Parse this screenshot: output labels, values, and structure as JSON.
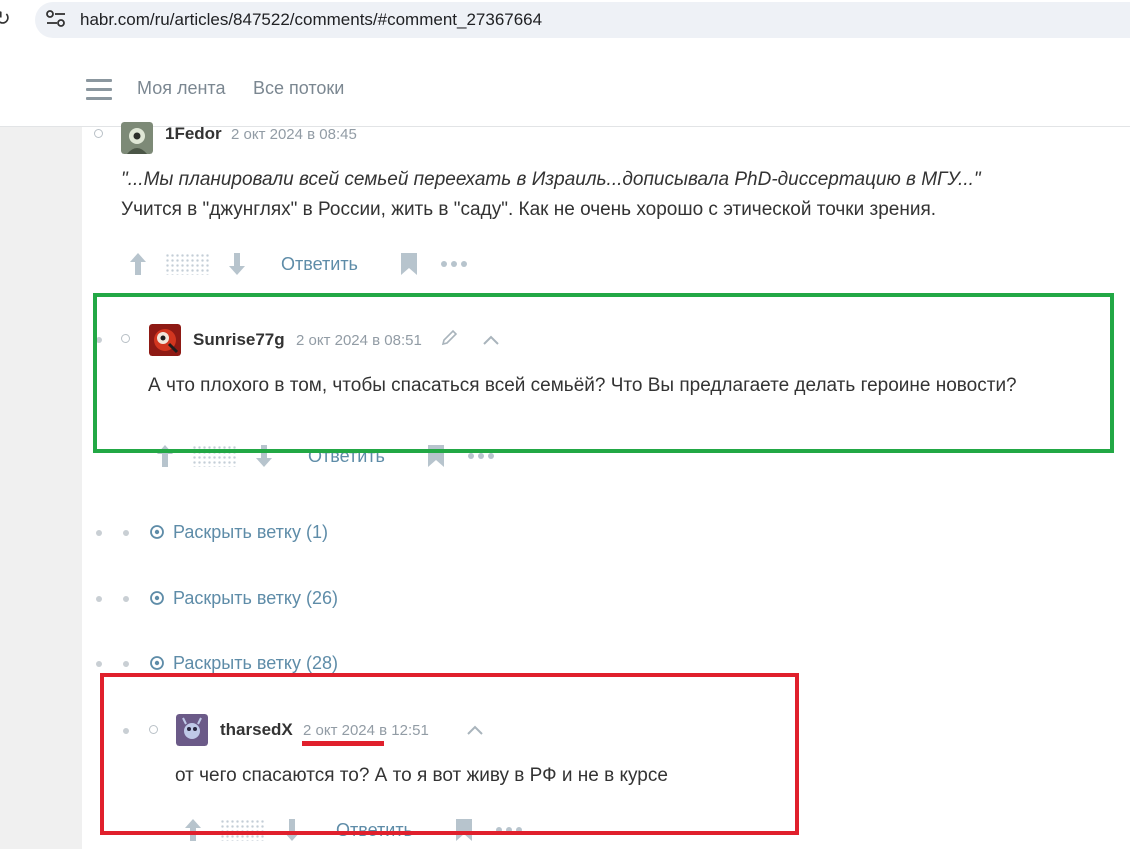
{
  "browser": {
    "url": "habr.com/ru/articles/847522/comments/#comment_27367664"
  },
  "header": {
    "nav": [
      "Моя лента",
      "Все потоки"
    ]
  },
  "comments": [
    {
      "author": "1Fedor",
      "date": "2 окт 2024 в 08:45",
      "line1": "\"...Мы планировали всей семьей переехать в Израиль...дописывала PhD-диссертацию в МГУ...\"",
      "line2": "Учится в \"джунглях\" в России, жить в \"саду\". Как не очень хорошо с этической точки зрения.",
      "reply_label": "Ответить"
    },
    {
      "author": "Sunrise77g",
      "date": "2 окт 2024 в 08:51",
      "text": "А что плохого в том, чтобы спасаться всей семьёй? Что Вы предлагаете делать героине новости?",
      "reply_label": "Ответить"
    },
    {
      "author": "tharsedX",
      "date_part": "2 окт 2024",
      "time_part": " в 12:51",
      "text": "от чего спасаются то? А то я вот живу в РФ и не в курсе",
      "reply_label": "Ответить"
    }
  ],
  "branches": [
    {
      "label": "Раскрыть ветку (1)"
    },
    {
      "label": "Раскрыть ветку (26)"
    },
    {
      "label": "Раскрыть ветку (28)"
    }
  ],
  "colors": {
    "highlight_green": "#22a845",
    "highlight_red": "#e0202c",
    "link": "#5e8ca8"
  }
}
